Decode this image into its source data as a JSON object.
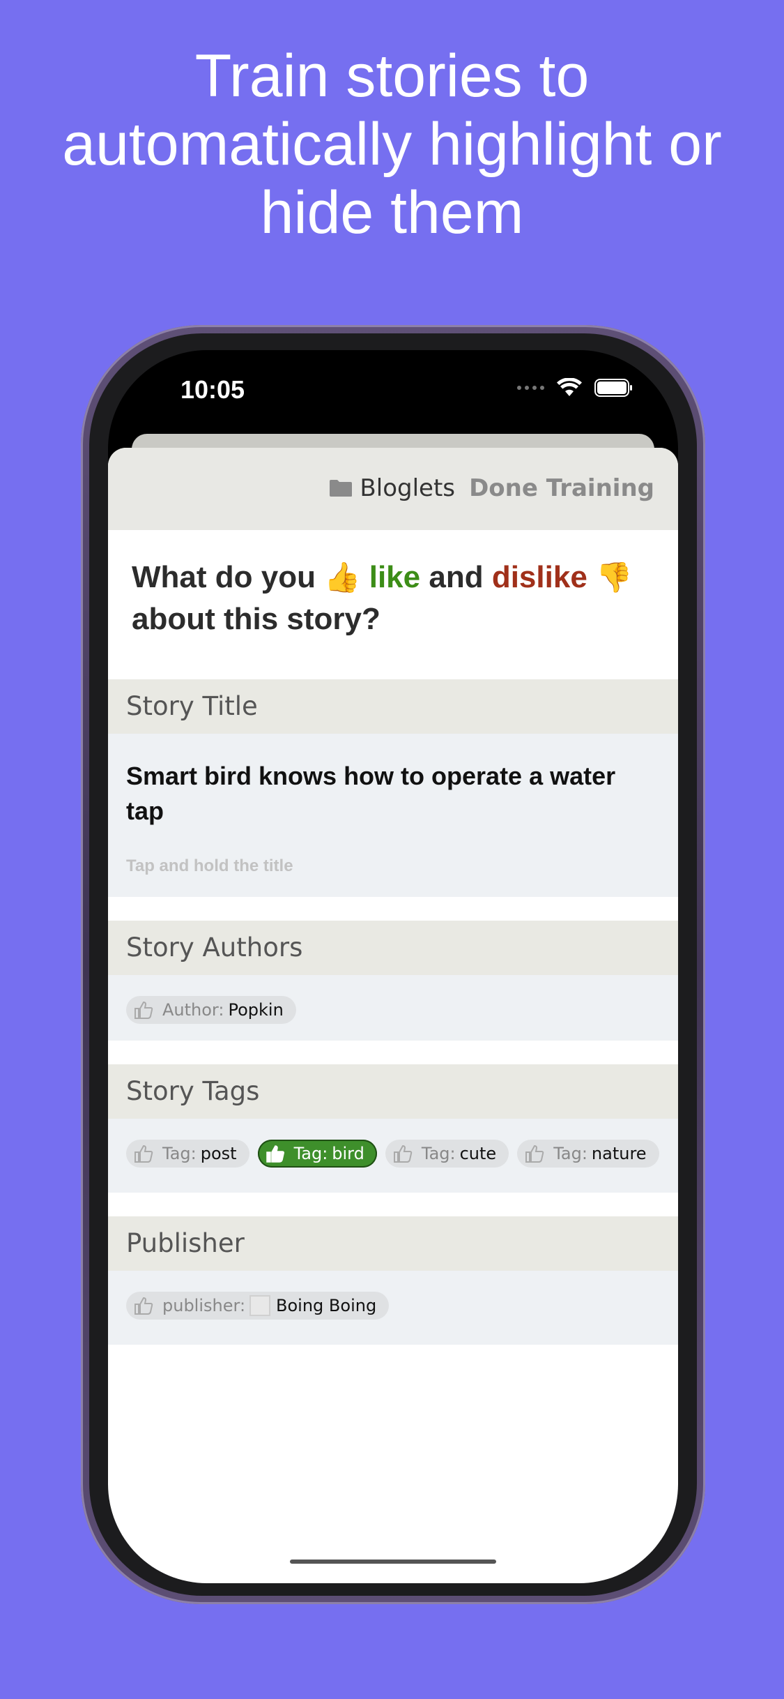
{
  "headline": [
    "Train stories to",
    "automatically highlight or",
    "hide them"
  ],
  "status_bar": {
    "time": "10:05"
  },
  "nav": {
    "folder": "Bloglets",
    "done": "Done Training"
  },
  "question": {
    "prefix": "What do you",
    "like_emoji": "👍",
    "like": "like",
    "and": "and",
    "dislike": "dislike",
    "dislike_emoji": "👎",
    "suffix": "about this story?"
  },
  "sections": {
    "title": {
      "header": "Story Title",
      "story_title": "Smart bird knows how to operate a water tap",
      "hint": "Tap and hold the title"
    },
    "authors": {
      "header": "Story Authors",
      "chips": [
        {
          "label": "Author:",
          "value": "Popkin",
          "liked": false
        }
      ]
    },
    "tags": {
      "header": "Story Tags",
      "chips": [
        {
          "label": "Tag:",
          "value": "post",
          "liked": false
        },
        {
          "label": "Tag:",
          "value": "bird",
          "liked": true
        },
        {
          "label": "Tag:",
          "value": "cute",
          "liked": false
        },
        {
          "label": "Tag:",
          "value": "nature",
          "liked": false
        }
      ]
    },
    "publisher": {
      "header": "Publisher",
      "chips": [
        {
          "label": "publisher:",
          "value": "Boing Boing",
          "liked": false
        }
      ]
    }
  },
  "colors": {
    "background": "#766ff0",
    "like": "#3c8d17",
    "dislike": "#a0301a",
    "liked_chip": "#3e8f2b"
  },
  "icons": [
    "folder-icon",
    "thumbs-up-icon",
    "wifi-icon",
    "battery-icon",
    "cellular-icon"
  ]
}
